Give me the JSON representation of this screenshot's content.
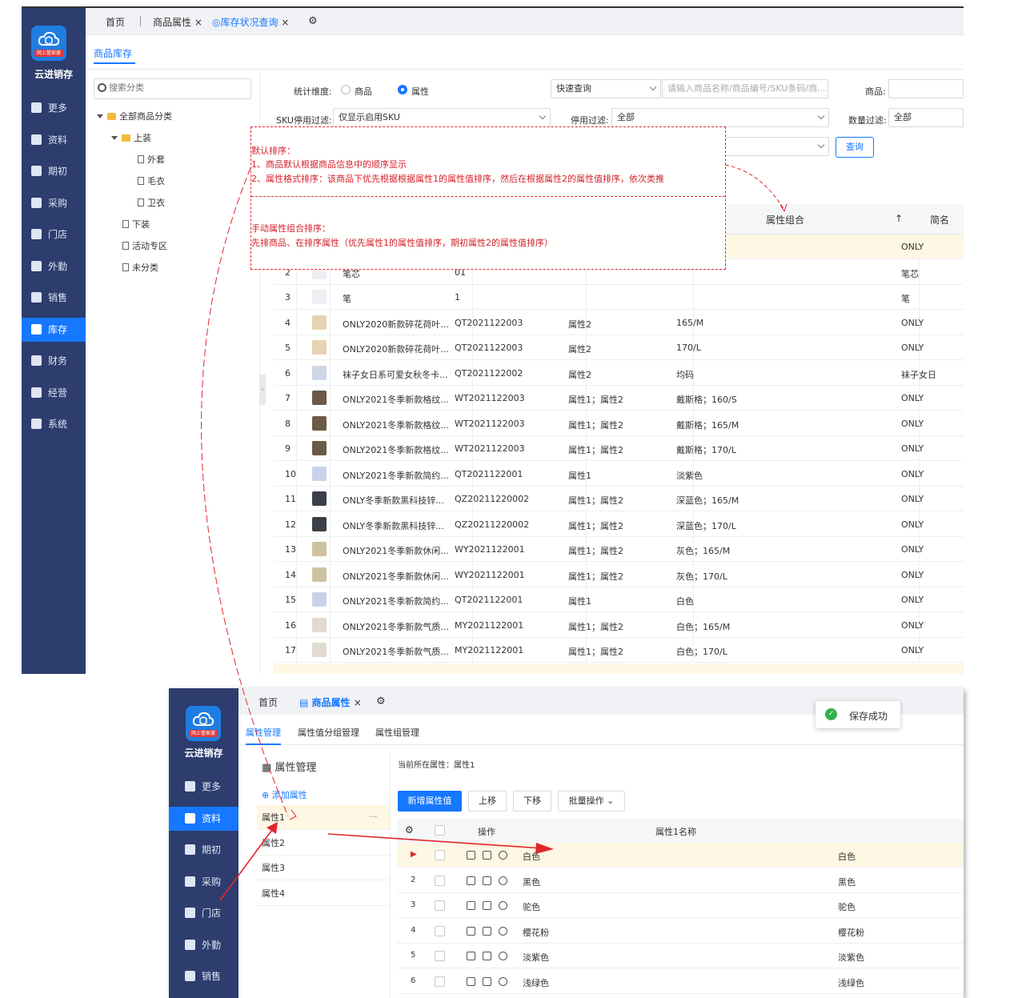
{
  "app": {
    "name": "云进销存",
    "tagline": "网上管家婆"
  },
  "shot1": {
    "nav": [
      "更多",
      "资料",
      "期初",
      "采购",
      "门店",
      "外勤",
      "销售",
      "库存",
      "财务",
      "经营",
      "系统"
    ],
    "tabs": {
      "home": "首页",
      "attr": "商品属性",
      "stock": "库存状况查询"
    },
    "subtab": "商品库存",
    "search_placeholder": "搜索分类",
    "tree": {
      "root": "全部商品分类",
      "top": "上装",
      "c1": "外套",
      "c2": "毛衣",
      "c3": "卫衣",
      "n2": "下装",
      "n3": "活动专区",
      "n4": "未分类"
    },
    "filters": {
      "dim_label": "统计维度:",
      "opt_goods": "商品",
      "opt_attr": "属性",
      "quick": "快速查询",
      "quick_placeholder": "请输入商品名称/商品编号/SKU条码/商...",
      "goods_label": "商品:",
      "sku_label": "SKU停用过滤:",
      "sku_value": "仅显示启用SKU",
      "stop_label": "停用过滤:",
      "stop_value": "全部",
      "qty_label": "数量过滤:",
      "qty_value": "全部",
      "query_btn": "查询"
    },
    "grid": {
      "head_combo": "属性组合",
      "head_sort": "↑",
      "head_short": "简名",
      "top_short": "ONLY",
      "rows": [
        {
          "n": "2",
          "name": "笔芯",
          "code": "01",
          "attr": "",
          "combo": "",
          "short": "笔芯"
        },
        {
          "n": "3",
          "name": "笔",
          "code": "1",
          "attr": "",
          "combo": "",
          "short": "笔"
        },
        {
          "n": "4",
          "name": "ONLY2020新款碎花荷叶...",
          "code": "QT2021122003",
          "attr": "属性2",
          "combo": "165/M",
          "short": "ONLY"
        },
        {
          "n": "5",
          "name": "ONLY2020新款碎花荷叶...",
          "code": "QT2021122003",
          "attr": "属性2",
          "combo": "170/L",
          "short": "ONLY"
        },
        {
          "n": "6",
          "name": "袜子女日系可爱女秋冬卡...",
          "code": "QT2021122002",
          "attr": "属性2",
          "combo": "均码",
          "short": "袜子女日"
        },
        {
          "n": "7",
          "name": "ONLY2021冬季新款格纹...",
          "code": "WT2021122003",
          "attr": "属性1；属性2",
          "combo": "戴斯格；160/S",
          "short": "ONLY"
        },
        {
          "n": "8",
          "name": "ONLY2021冬季新款格纹...",
          "code": "WT2021122003",
          "attr": "属性1；属性2",
          "combo": "戴斯格；165/M",
          "short": "ONLY"
        },
        {
          "n": "9",
          "name": "ONLY2021冬季新款格纹...",
          "code": "WT2021122003",
          "attr": "属性1；属性2",
          "combo": "戴斯格；170/L",
          "short": "ONLY"
        },
        {
          "n": "10",
          "name": "ONLY2021冬季新款简约...",
          "code": "QT2021122001",
          "attr": "属性1",
          "combo": "淡紫色",
          "short": "ONLY"
        },
        {
          "n": "11",
          "name": "ONLY冬季新款黑科技锌...",
          "code": "QZ20211220002",
          "attr": "属性1；属性2",
          "combo": "深蓝色；165/M",
          "short": "ONLY"
        },
        {
          "n": "12",
          "name": "ONLY冬季新款黑科技锌...",
          "code": "QZ20211220002",
          "attr": "属性1；属性2",
          "combo": "深蓝色；170/L",
          "short": "ONLY"
        },
        {
          "n": "13",
          "name": "ONLY2021冬季新款休闲...",
          "code": "WY2021122001",
          "attr": "属性1；属性2",
          "combo": "灰色；165/M",
          "short": "ONLY"
        },
        {
          "n": "14",
          "name": "ONLY2021冬季新款休闲...",
          "code": "WY2021122001",
          "attr": "属性1；属性2",
          "combo": "灰色；170/L",
          "short": "ONLY"
        },
        {
          "n": "15",
          "name": "ONLY2021冬季新款简约...",
          "code": "QT2021122001",
          "attr": "属性1",
          "combo": "白色",
          "short": "ONLY"
        },
        {
          "n": "16",
          "name": "ONLY2021冬季新款气质...",
          "code": "MY2021122001",
          "attr": "属性1；属性2",
          "combo": "白色；165/M",
          "short": "ONLY"
        },
        {
          "n": "17",
          "name": "ONLY2021冬季新款气质...",
          "code": "MY2021122001",
          "attr": "属性1；属性2",
          "combo": "白色；170/L",
          "short": "ONLY"
        }
      ]
    },
    "annotation": {
      "t1": "默认排序：",
      "t2": "1、商品默认根据商品信息中的顺序显示",
      "t3": "2、属性格式排序：该商品下优先根据根据属性1的属性值排序，然后在根据属性2的属性值排序，依次类推",
      "t4": "手动属性组合排序：",
      "t5": "先排商品、在排序属性（优先属性1的属性值排序，期初属性2的属性值排序）"
    }
  },
  "shot2": {
    "nav": [
      "更多",
      "资料",
      "期初",
      "采购",
      "门店",
      "外勤",
      "销售"
    ],
    "tabs": {
      "home": "首页",
      "attr": "商品属性"
    },
    "subtabs": [
      "属性管理",
      "属性值分组管理",
      "属性组管理"
    ],
    "toast": "保存成功",
    "panel_title": "属性管理",
    "add_attr": "添加属性",
    "more": "···",
    "attrs": [
      "属性1",
      "属性2",
      "属性3",
      "属性4"
    ],
    "current_label": "当前所在属性：",
    "current_value": "属性1",
    "buttons": {
      "new": "新增属性值",
      "up": "上移",
      "down": "下移",
      "batch": "批量操作"
    },
    "table": {
      "h_op": "操作",
      "h_name": "属性1名称",
      "rows": [
        {
          "n": "▶",
          "name": "白色",
          "val": "白色"
        },
        {
          "n": "2",
          "name": "黑色",
          "val": "黑色"
        },
        {
          "n": "3",
          "name": "驼色",
          "val": "驼色"
        },
        {
          "n": "4",
          "name": "樱花粉",
          "val": "樱花粉"
        },
        {
          "n": "5",
          "name": "淡紫色",
          "val": "淡紫色"
        },
        {
          "n": "6",
          "name": "浅绿色",
          "val": "浅绿色"
        }
      ]
    }
  },
  "colors": {
    "nav_bg": "#2c3d6e",
    "accent": "#1677ff",
    "annotation": "#e2262d",
    "highlight": "#fdf7e3"
  }
}
